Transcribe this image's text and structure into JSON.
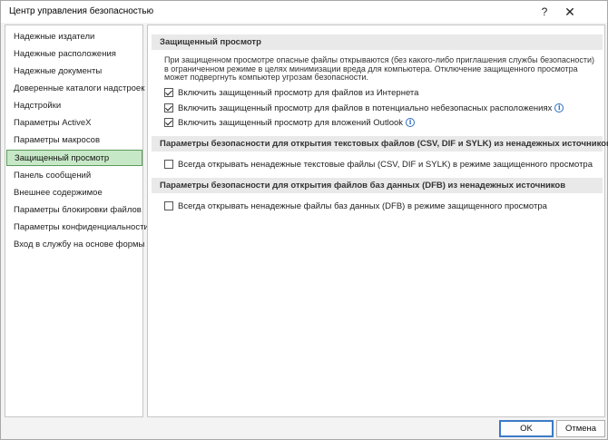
{
  "window": {
    "title": "Центр управления безопасностью",
    "help_glyph": "?",
    "close_glyph": "✕"
  },
  "sidebar": {
    "items": [
      {
        "label": "Надежные издатели",
        "selected": false
      },
      {
        "label": "Надежные расположения",
        "selected": false
      },
      {
        "label": "Надежные документы",
        "selected": false
      },
      {
        "label": "Доверенные каталоги надстроек",
        "selected": false
      },
      {
        "label": "Надстройки",
        "selected": false
      },
      {
        "label": "Параметры ActiveX",
        "selected": false
      },
      {
        "label": "Параметры макросов",
        "selected": false
      },
      {
        "label": "Защищенный просмотр",
        "selected": true
      },
      {
        "label": "Панель сообщений",
        "selected": false
      },
      {
        "label": "Внешнее содержимое",
        "selected": false
      },
      {
        "label": "Параметры блокировки файлов",
        "selected": false
      },
      {
        "label": "Параметры конфиденциальности",
        "selected": false
      },
      {
        "label": "Вход в службу на основе формы",
        "selected": false
      }
    ]
  },
  "main": {
    "protected_view": {
      "header": "Защищенный просмотр",
      "description": "При защищенном просмотре опасные файлы открываются (без какого-либо приглашения службы безопасности) в ограниченном режиме в целях минимизации вреда для компьютера. Отключение защищенного просмотра может подвергнуть компьютер угрозам безопасности.",
      "options": [
        {
          "label": "Включить защищенный просмотр для файлов из Интернета",
          "checked": true,
          "info": false
        },
        {
          "label": "Включить защищенный просмотр для файлов в потенциально небезопасных расположениях",
          "checked": true,
          "info": true
        },
        {
          "label": "Включить защищенный просмотр для вложений Outlook",
          "checked": true,
          "info": true
        }
      ]
    },
    "text_files": {
      "header": "Параметры безопасности для открытия текстовых файлов (CSV, DIF и SYLK) из ненадежных источников",
      "option": {
        "label": "Всегда открывать ненадежные текстовые файлы (CSV, DIF и SYLK) в режиме защищенного просмотра",
        "checked": false
      }
    },
    "db_files": {
      "header": "Параметры безопасности для открытия файлов баз данных (DFB) из ненадежных источников",
      "option": {
        "label": "Всегда открывать ненадежные файлы баз данных (DFB) в режиме защищенного просмотра",
        "checked": false
      }
    }
  },
  "footer": {
    "ok_label": "OK",
    "cancel_label": "Отмена"
  },
  "colors": {
    "selected_bg": "#c7e8c7",
    "selected_border": "#5a9a5a",
    "info_icon": "#2b6cc4"
  }
}
